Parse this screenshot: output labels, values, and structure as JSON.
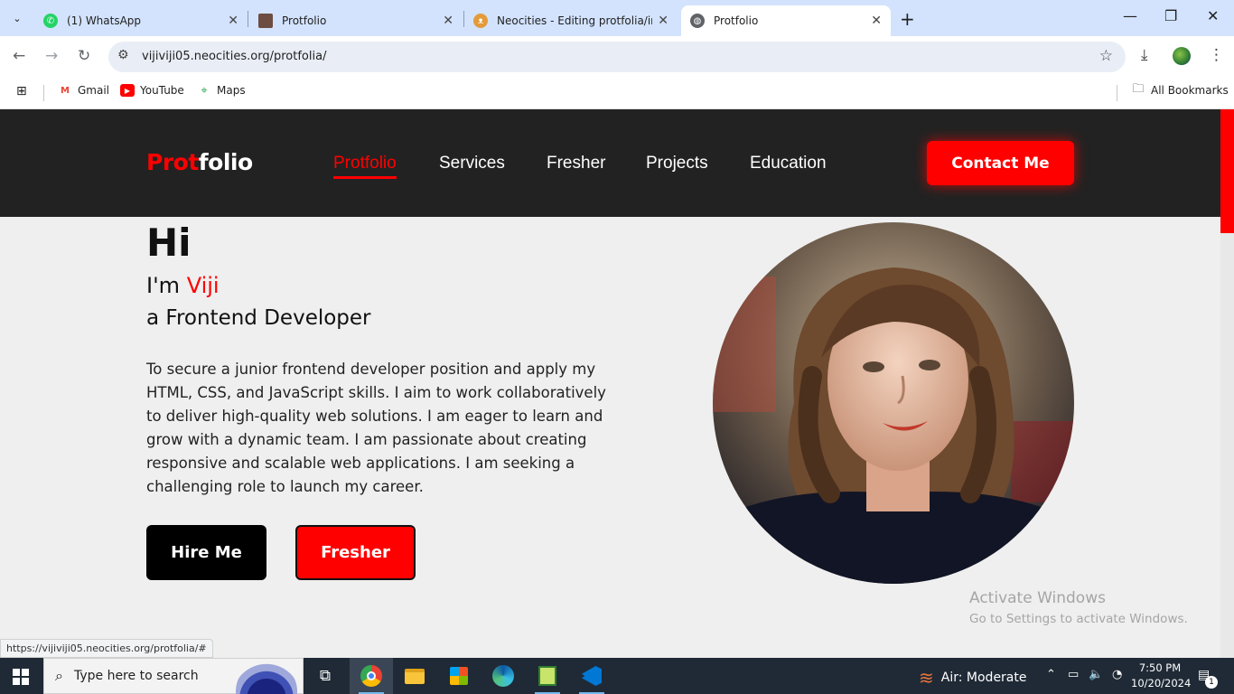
{
  "browser": {
    "tabs": [
      {
        "title": "(1) WhatsApp",
        "icon": "whatsapp-icon"
      },
      {
        "title": "Protfolio",
        "icon": "portrait-favicon"
      },
      {
        "title": "Neocities - Editing protfolia/index",
        "icon": "neocities-cat-icon"
      },
      {
        "title": "Protfolio",
        "icon": "globe-icon",
        "active": true
      }
    ],
    "url": "vijiviji05.neocities.org/protfolia/",
    "bookmarks": [
      {
        "label": "Gmail",
        "icon": "gmail-icon",
        "color": "#ea4335"
      },
      {
        "label": "YouTube",
        "icon": "youtube-icon",
        "color": "#ff0000"
      },
      {
        "label": "Maps",
        "icon": "maps-icon",
        "color": "#34a853"
      }
    ],
    "all_bookmarks": "All Bookmarks",
    "status_link": "https://vijiviji05.neocities.org/protfolia/#"
  },
  "site": {
    "logo_part1": "Prot",
    "logo_part2": "folio",
    "nav": [
      "Protfolio",
      "Services",
      "Fresher",
      "Projects",
      "Education"
    ],
    "nav_current": "Protfolio",
    "contact_button": "Contact Me",
    "greeting": "Hi",
    "intro_prefix": "I'm ",
    "name": "Viji",
    "role": "a Frontend Developer",
    "bio": "To secure a junior frontend developer position and apply my HTML, CSS, and JavaScript skills. I aim to work collaboratively to deliver high-quality web solutions. I am eager to learn and grow with a dynamic team. I am passionate about creating responsive and scalable web applications. I am seeking a challenging role to launch my career.",
    "hire_button": "Hire Me",
    "fresher_button": "Fresher",
    "accent_color": "#ff0000",
    "header_color": "#222222"
  },
  "watermark": {
    "line1": "Activate Windows",
    "line2": "Go to Settings to activate Windows."
  },
  "taskbar": {
    "search_placeholder": "Type here to search",
    "weather": "Air: Moderate",
    "time": "7:50 PM",
    "date": "10/20/2024",
    "notification_count": "1",
    "apps": [
      "task-view-icon",
      "chrome-icon",
      "file-explorer-icon",
      "store-icon",
      "edge-icon",
      "notepad-icon",
      "vscode-icon"
    ]
  }
}
